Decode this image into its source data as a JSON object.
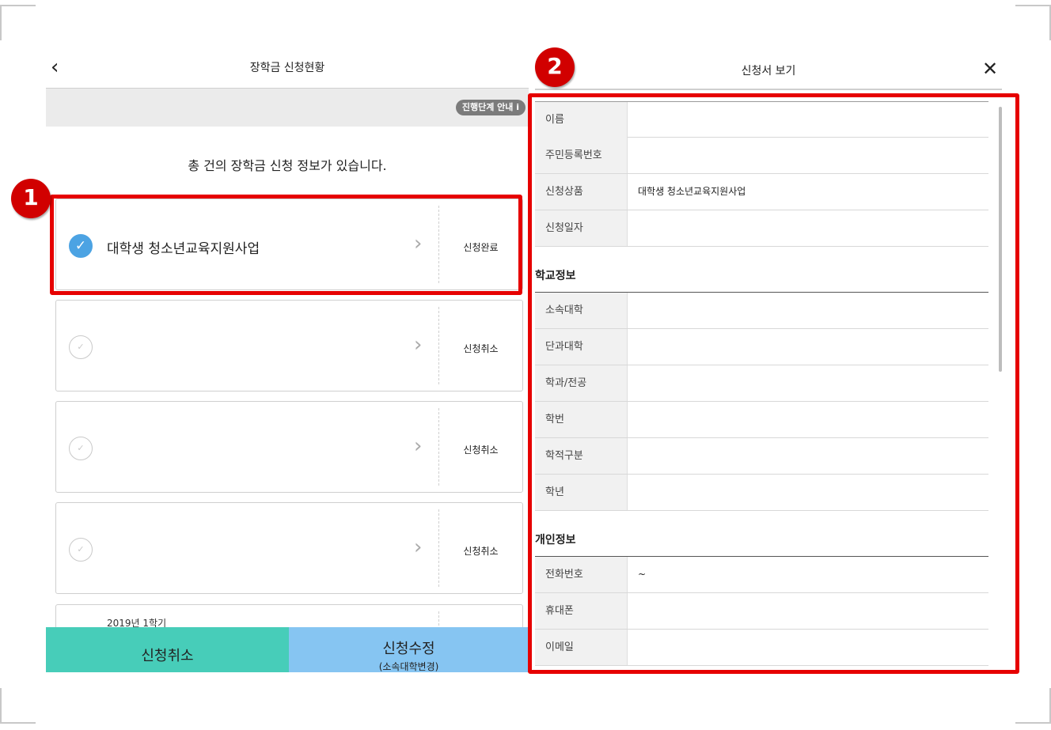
{
  "left": {
    "title": "장학금 신청현황",
    "back_icon": "chevron-left-icon",
    "stage_guide": "진행단계 안내 i",
    "summary": "총  건의 장학금 신청 정보가 있습니다.",
    "cards": [
      {
        "name": "대학생 청소년교육지원사업",
        "status": "신청완료",
        "checked": true
      },
      {
        "name": "",
        "status": "신청취소",
        "checked": false
      },
      {
        "name": "",
        "status": "신청취소",
        "checked": false
      },
      {
        "name": "",
        "status": "신청취소",
        "checked": false
      },
      {
        "year": "2019년 1학기"
      }
    ],
    "cancel_button": "신청취소",
    "modify_button": "신청수정",
    "modify_sub": "(소속대학변경)"
  },
  "right": {
    "title": "신청서 보기",
    "close_icon": "close-icon",
    "rows1": [
      {
        "label": "이름",
        "value": ""
      },
      {
        "label": "주민등록번호",
        "value": ""
      },
      {
        "label": "신청상품",
        "value": "대학생 청소년교육지원사업"
      },
      {
        "label": "신청일자",
        "value": ""
      }
    ],
    "section_school": "학교정보",
    "rows2": [
      {
        "label": "소속대학",
        "value": ""
      },
      {
        "label": "단과대학",
        "value": ""
      },
      {
        "label": "학과/전공",
        "value": ""
      },
      {
        "label": "학번",
        "value": ""
      },
      {
        "label": "학적구분",
        "value": ""
      },
      {
        "label": "학년",
        "value": ""
      }
    ],
    "section_personal": "개인정보",
    "rows3": [
      {
        "label": "전화번호",
        "value": "~"
      },
      {
        "label": "휴대폰",
        "value": ""
      },
      {
        "label": "이메일",
        "value": ""
      }
    ]
  },
  "annotations": {
    "badge1": "1",
    "badge2": "2",
    "color": "#e60000"
  },
  "colors": {
    "check_done": "#4ca3e3",
    "cancel_bg": "#47cdb9",
    "modify_bg": "#86c5f2"
  }
}
